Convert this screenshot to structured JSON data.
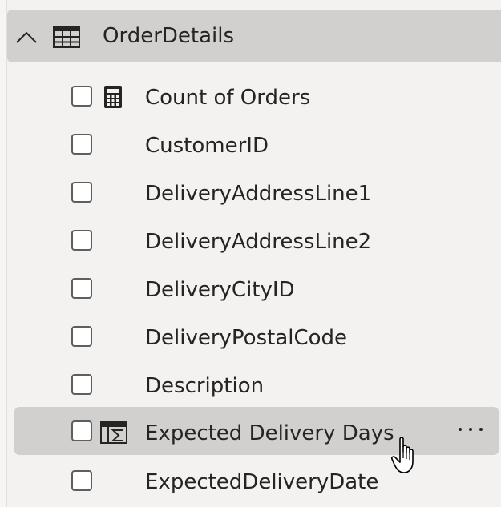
{
  "table": {
    "name": "OrderDetails",
    "expanded": true
  },
  "fields": [
    {
      "label": "Count of Orders",
      "icon": "calculator-icon",
      "checked": false
    },
    {
      "label": "CustomerID",
      "icon": "",
      "checked": false
    },
    {
      "label": "DeliveryAddressLine1",
      "icon": "",
      "checked": false
    },
    {
      "label": "DeliveryAddressLine2",
      "icon": "",
      "checked": false
    },
    {
      "label": "DeliveryCityID",
      "icon": "",
      "checked": false
    },
    {
      "label": "DeliveryPostalCode",
      "icon": "",
      "checked": false
    },
    {
      "label": "Description",
      "icon": "",
      "checked": false
    },
    {
      "label": "Expected Delivery Days",
      "icon": "calculated-column-icon",
      "checked": false,
      "hovered": true
    },
    {
      "label": "ExpectedDeliveryDate",
      "icon": "",
      "checked": false
    }
  ],
  "more_options_label": "···",
  "colors": {
    "pane_background": "#f3f2f1",
    "highlight": "#d2d0ce",
    "text": "#252423",
    "checkbox_border": "#605e5c"
  }
}
